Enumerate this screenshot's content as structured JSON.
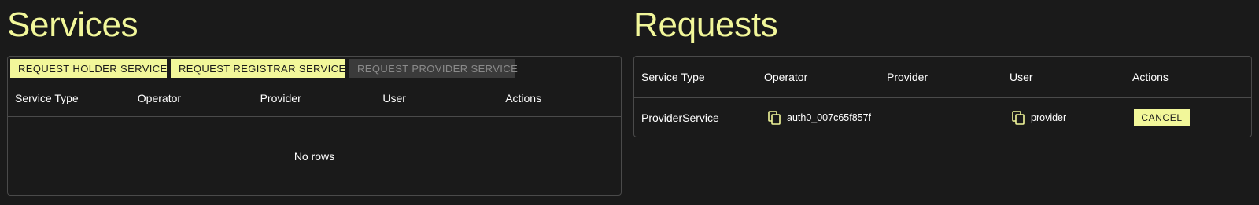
{
  "services": {
    "title": "Services",
    "toolbar": {
      "request_holder": "REQUEST HOLDER SERVICE",
      "request_registrar": "REQUEST REGISTRAR SERVICE",
      "request_provider": "REQUEST PROVIDER SERVICE"
    },
    "columns": [
      "Service Type",
      "Operator",
      "Provider",
      "User",
      "Actions"
    ],
    "empty_text": "No rows"
  },
  "requests": {
    "title": "Requests",
    "columns": [
      "Service Type",
      "Operator",
      "Provider",
      "User",
      "Actions"
    ],
    "rows": [
      {
        "service_type": "ProviderService",
        "operator": "auth0_007c65f857f",
        "provider": "",
        "user": "provider",
        "action": "CANCEL"
      }
    ]
  },
  "colors": {
    "background": "#1a1a1a",
    "accent": "#f2f79a",
    "border": "#4a4a4a",
    "disabled_bg": "#3b3b3b",
    "disabled_text": "#8a8a8a"
  },
  "icons": {
    "copy": "copy-icon"
  }
}
